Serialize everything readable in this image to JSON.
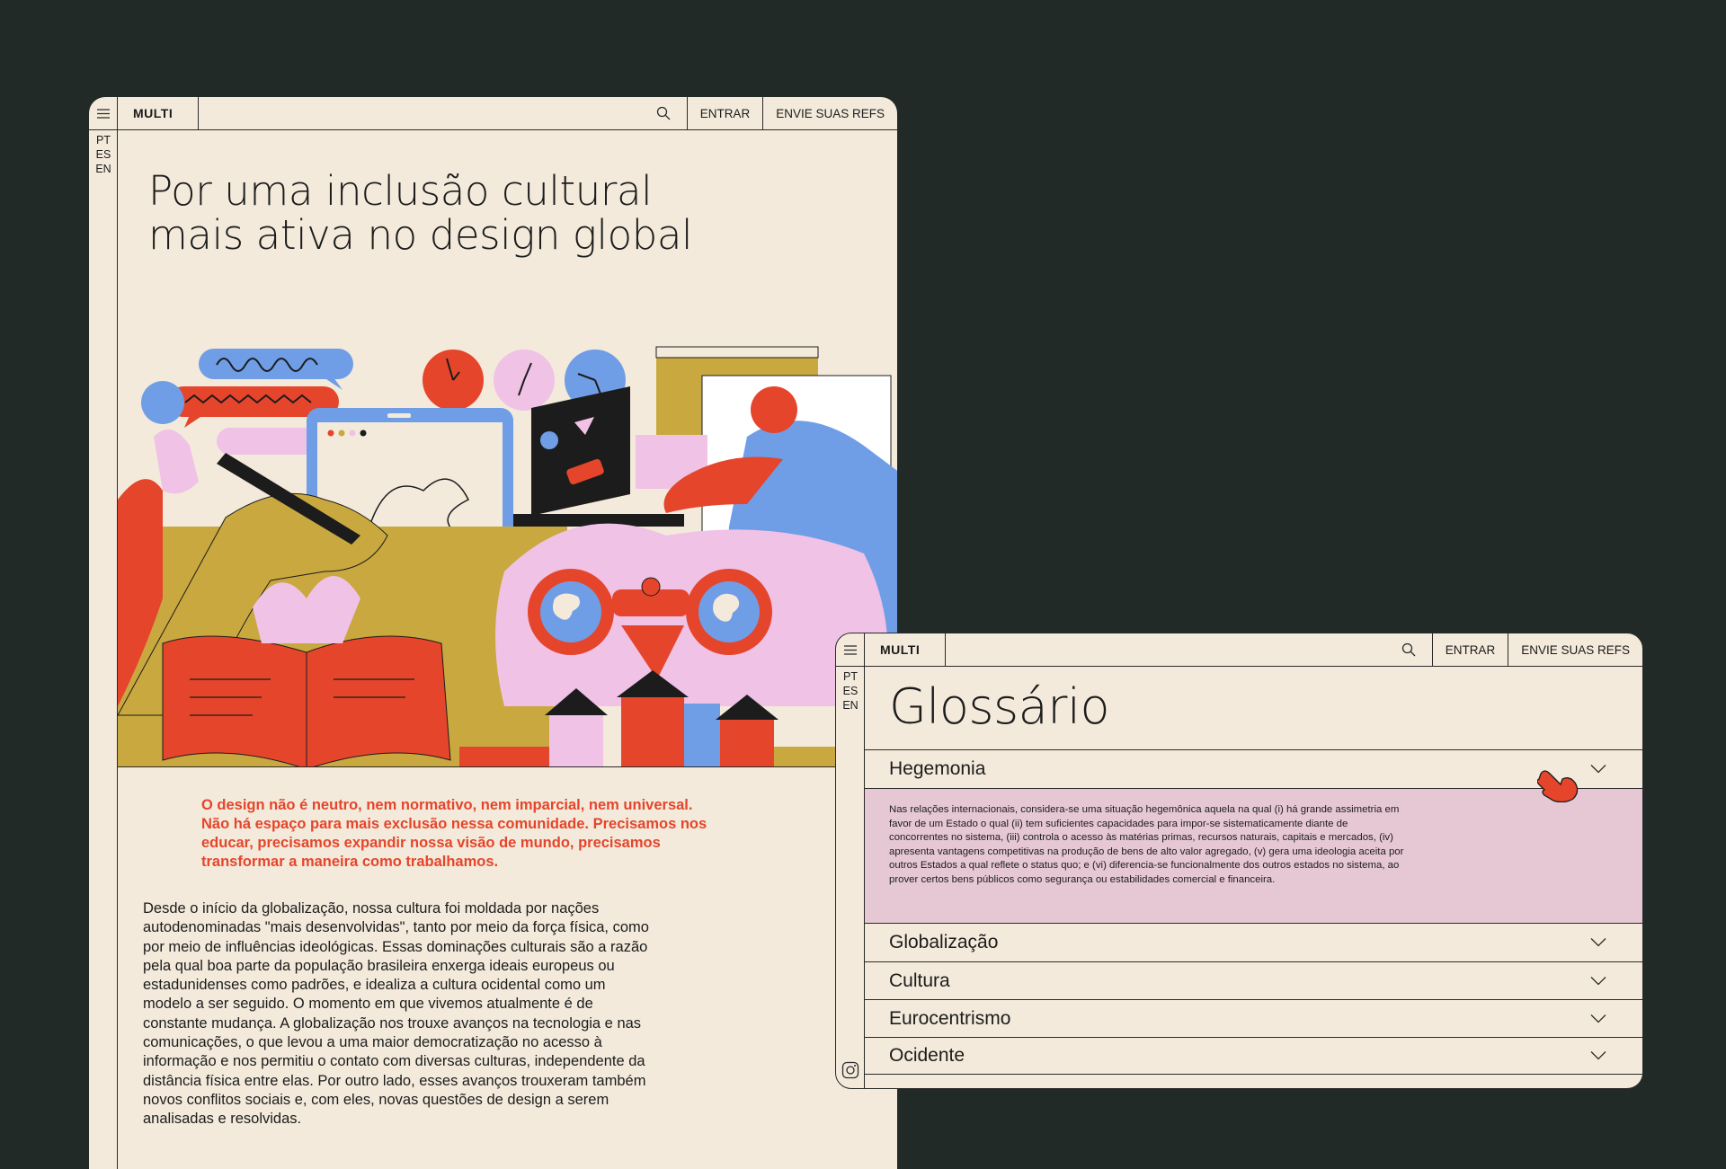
{
  "colors": {
    "background": "#222a27",
    "paper": "#f3eadb",
    "accent_red": "#e5452b",
    "accent_blue": "#6f9ee6",
    "accent_pink": "#f0c2e6",
    "accent_mustard": "#c9a840",
    "glossary_highlight": "#e6c7d4"
  },
  "article": {
    "header": {
      "logo": "MULTI",
      "search_icon": "search-icon",
      "login": "ENTRAR",
      "submit_refs": "ENVIE SUAS REFS"
    },
    "languages": [
      "PT",
      "ES",
      "EN"
    ],
    "title_line1": "Por uma inclusão cultural",
    "title_line2": "mais ativa no design global",
    "lead": "O design não é neutro, nem normativo, nem imparcial, nem universal. Não há espaço para mais exclusão nessa comunidade. Precisamos nos educar, precisamos expandir nossa visão de mundo, precisamos transformar a maneira como trabalhamos.",
    "body": "Desde o início da globalização, nossa cultura foi moldada por nações autodenominadas \"mais desenvolvidas\", tanto por meio da força física, como por meio de influências ideológicas. Essas dominações culturais são a razão pela qual boa parte da população brasileira enxerga ideais europeus ou estadunidenses como padrões, e idealiza a cultura ocidental como um modelo a ser seguido. O momento em que vivemos atualmente é de constante mudança. A globalização nos trouxe avanços na tecnologia e nas comunicações, o que levou a uma maior democratização no acesso à informação e nos permitiu o contato com diversas culturas, independente da distância física entre elas. Por outro lado, esses avanços trouxeram também novos conflitos sociais e, com eles, novas questões de design a serem analisadas e resolvidas."
  },
  "glossary": {
    "header": {
      "logo": "MULTI",
      "login": "ENTRAR",
      "submit_refs": "ENVIE SUAS REFS"
    },
    "languages": [
      "PT",
      "ES",
      "EN"
    ],
    "title": "Glossário",
    "items": [
      {
        "term": "Hegemonia",
        "expanded": true,
        "definition": "Nas relações internacionais, considera-se uma situação hegemônica aquela na qual (i) há grande assimetria em favor de um Estado o qual (ii) tem suficientes capacidades para impor-se sistematicamente diante de concorrentes no sistema, (iii) controla o acesso às matérias primas, recursos naturais, capitais e mercados, (iv) apresenta vantagens competitivas na produção de bens de alto valor agregado, (v) gera uma ideologia aceita por outros Estados a qual reflete o status quo; e (vi) diferencia-se funcionalmente dos outros estados no sistema, ao prover certos bens públicos como segurança ou estabilidades comercial e financeira."
      },
      {
        "term": "Globalização",
        "expanded": false
      },
      {
        "term": "Cultura",
        "expanded": false
      },
      {
        "term": "Eurocentrismo",
        "expanded": false
      },
      {
        "term": "Ocidente",
        "expanded": false
      }
    ]
  }
}
